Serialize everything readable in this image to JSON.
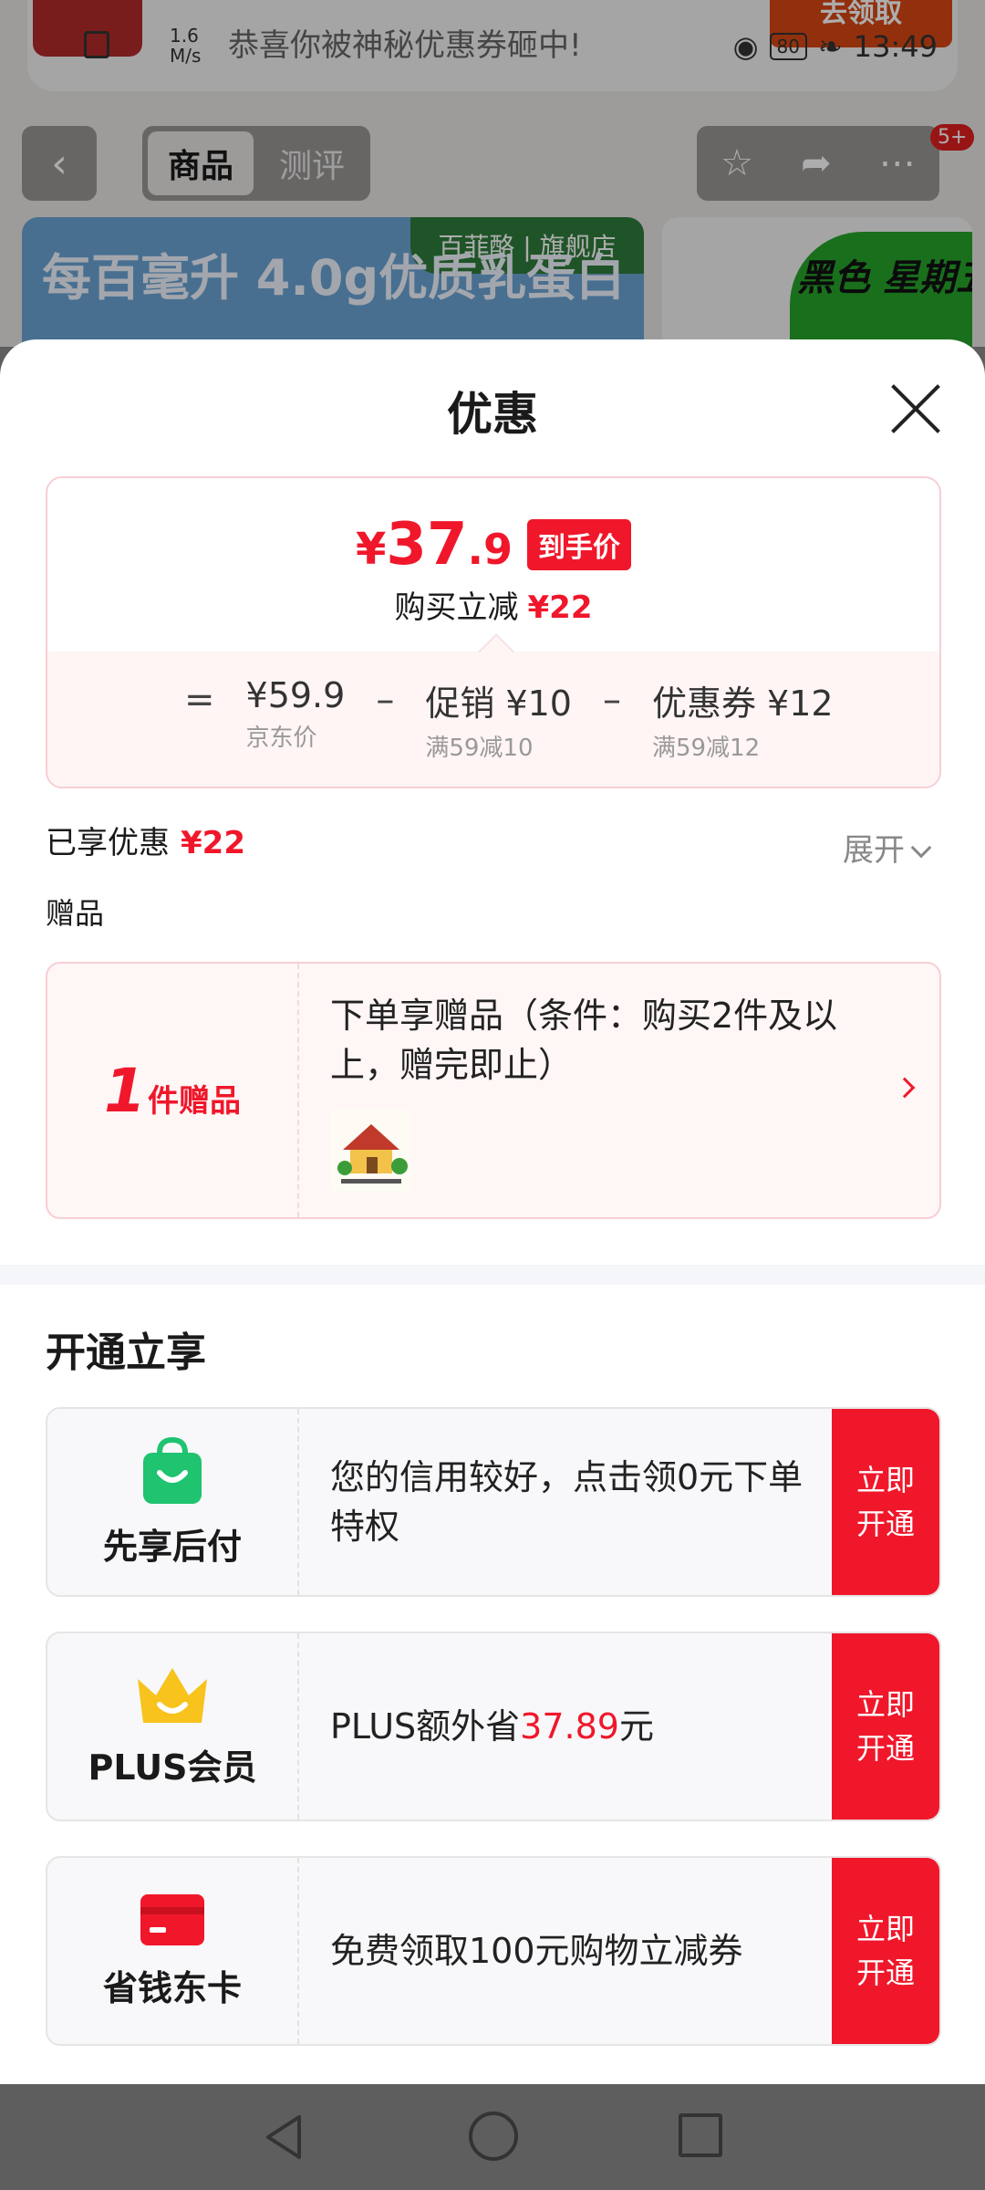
{
  "status_bar": {
    "net_speed": "1.6",
    "net_unit": "M/s",
    "battery": "80",
    "time": "13:49"
  },
  "background": {
    "banner_text": "恭喜你被神秘优惠券砸中!",
    "banner_button": "去领取",
    "tabs": [
      "商品",
      "测评"
    ],
    "badge": "5+",
    "card1_tag": "百菲酪 | 旗舰店",
    "card1_text": "每百毫升 4.0g优质乳蛋白",
    "card2_text": "黑色 星期五"
  },
  "sheet": {
    "title": "优惠",
    "price": {
      "yen": "¥",
      "int": "37",
      "dec": ".9",
      "tag": "到手价",
      "save_label": "购买立减",
      "save_amount": "¥22"
    },
    "formula": {
      "eq": "=",
      "minus": "–",
      "jd_price": "¥59.9",
      "jd_label": "京东价",
      "promo": "促销 ¥10",
      "promo_rule": "满59减10",
      "coupon": "优惠券 ¥12",
      "coupon_rule": "满59减12"
    },
    "enjoyed_label": "已享优惠",
    "enjoyed_amount": "¥22",
    "expand_label": "展开",
    "gift_section_label": "赠品",
    "gift": {
      "count": "1",
      "unit": "件赠品",
      "text": "下单享赠品（条件：购买2件及以上，赠完即止）"
    },
    "open_title": "开通立享",
    "services": [
      {
        "icon": "shopping-bag-icon",
        "name": "先享后付",
        "desc": "您的信用较好，点击领0元下单特权",
        "btn": "立即开通"
      },
      {
        "icon": "crown-icon",
        "name": "PLUS会员",
        "desc_pre": "PLUS额外省",
        "desc_amount": "37.89",
        "desc_post": "元",
        "btn": "立即开通"
      },
      {
        "icon": "card-icon",
        "name": "省钱东卡",
        "desc": "免费领取100元购物立减券",
        "btn": "立即开通"
      }
    ]
  },
  "colors": {
    "accent": "#f0172b",
    "plus_gold": "#f7c31c",
    "bag_green": "#1fc370"
  }
}
